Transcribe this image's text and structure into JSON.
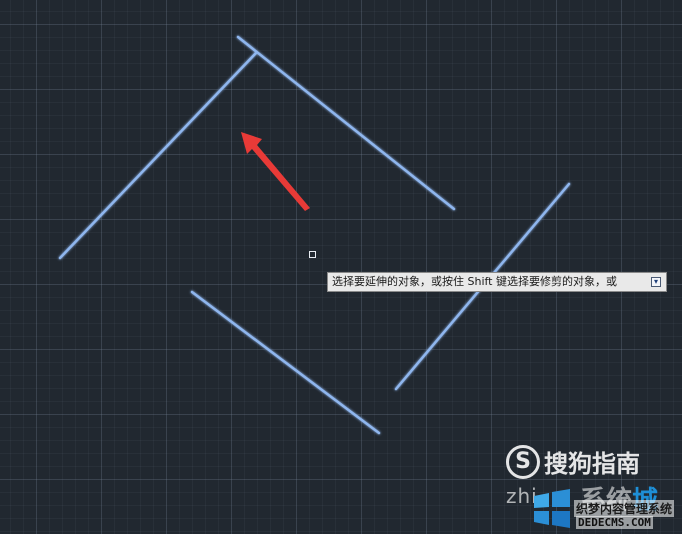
{
  "colors": {
    "background": "#212830",
    "line": "#8fb6ee",
    "arrow": "#e83a37"
  },
  "tooltip": {
    "text": "选择要延伸的对象，或按住 Shift 键选择要修剪的对象，或",
    "button_icon": "expand-icon",
    "button_glyph": "▾"
  },
  "watermark": {
    "logo_glyph": "S",
    "title": "搜狗指南",
    "subtitle": "zhi"
  },
  "watermark2": {
    "title_main": "系统",
    "title_accent": "城",
    "subtitle": "织梦内容管理系统",
    "url": "DEDECMS.COM"
  }
}
